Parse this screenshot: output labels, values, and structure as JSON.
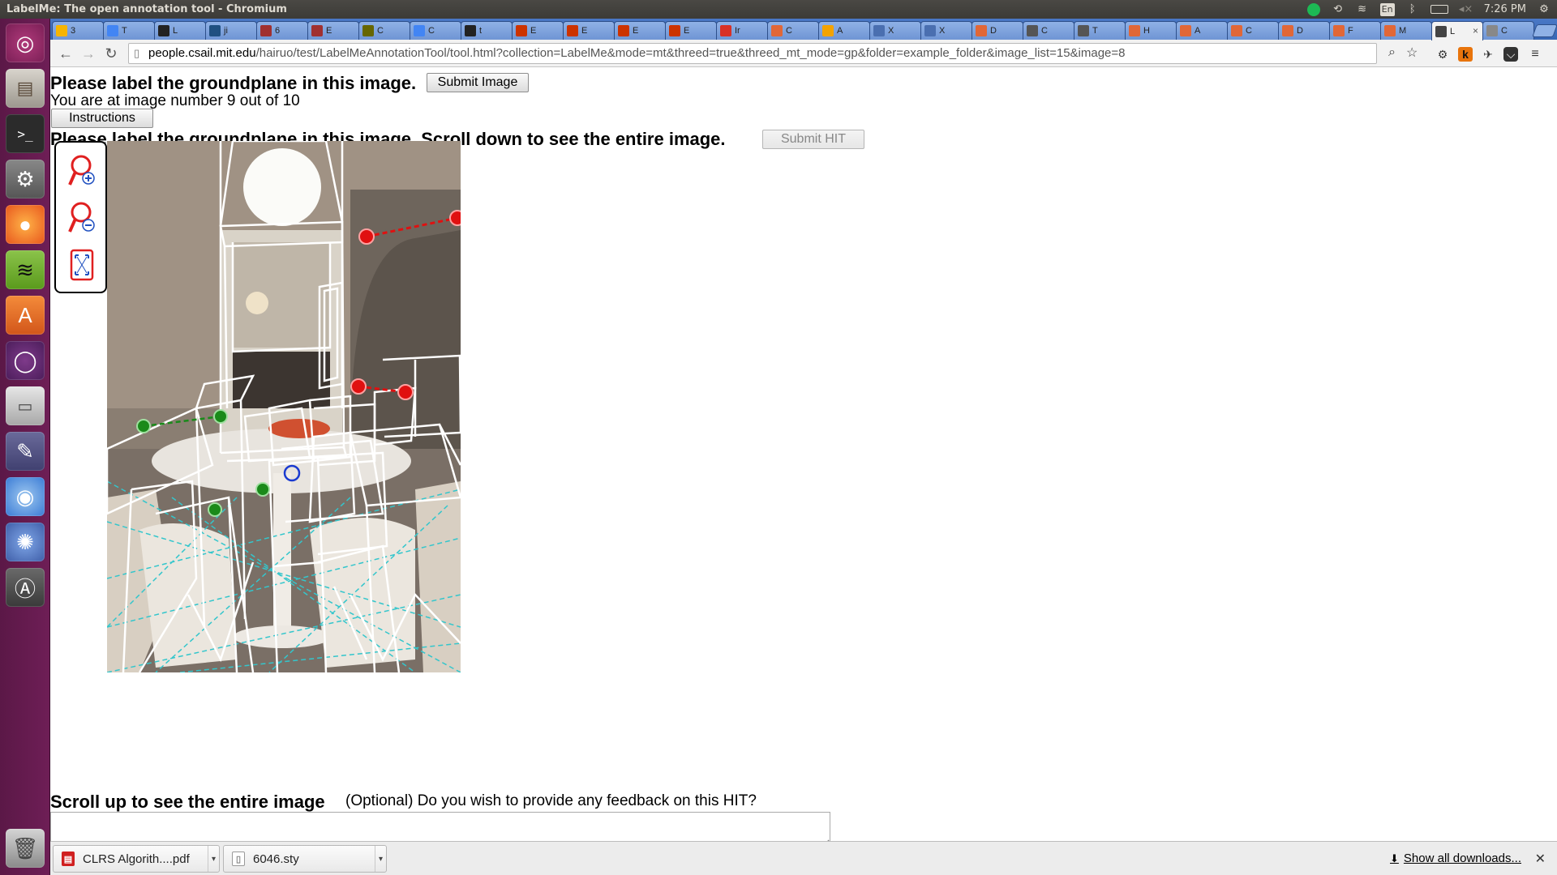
{
  "window": {
    "title": "LabelMe: The open annotation tool - Chromium"
  },
  "tray": {
    "clock": "7:26 PM",
    "keyboard": "En"
  },
  "launcher": {
    "items": [
      "ubuntu-home",
      "files",
      "terminal",
      "system-settings",
      "firefox",
      "spotify",
      "software-center",
      "ubuntu-one",
      "disk",
      "text-editor",
      "chromium",
      "shotwell",
      "software-updater",
      "trash"
    ]
  },
  "tabs": [
    {
      "icon": "drive-icon",
      "label": "3",
      "color": "#f6b400"
    },
    {
      "icon": "docs-icon",
      "label": "T",
      "color": "#4285f4"
    },
    {
      "icon": "github-icon",
      "label": "L",
      "color": "#222222"
    },
    {
      "icon": "jira-icon",
      "label": "ji",
      "color": "#205081"
    },
    {
      "icon": "bookmark-icon",
      "label": "6",
      "color": "#a03030"
    },
    {
      "icon": "bookmark-icon",
      "label": "E",
      "color": "#a03030"
    },
    {
      "icon": "misc-icon",
      "label": "C",
      "color": "#666600"
    },
    {
      "icon": "docs-icon",
      "label": "C",
      "color": "#4285f4"
    },
    {
      "icon": "github-icon",
      "label": "t",
      "color": "#222222"
    },
    {
      "icon": "wolfram-icon",
      "label": "E",
      "color": "#cc3300"
    },
    {
      "icon": "wolfram-icon",
      "label": "E",
      "color": "#cc3300"
    },
    {
      "icon": "wolfram-icon",
      "label": "E",
      "color": "#cc3300"
    },
    {
      "icon": "wolfram-icon",
      "label": "E",
      "color": "#cc3300"
    },
    {
      "icon": "gmail-icon",
      "label": "Ir",
      "color": "#d93025"
    },
    {
      "icon": "matlab-icon",
      "label": "C",
      "color": "#e16737"
    },
    {
      "icon": "circle-icon",
      "label": "A",
      "color": "#f4a300"
    },
    {
      "icon": "w3-icon",
      "label": "X",
      "color": "#4a6fb0"
    },
    {
      "icon": "w3-icon",
      "label": "X",
      "color": "#4a6fb0"
    },
    {
      "icon": "matlab-icon",
      "label": "D",
      "color": "#e16737"
    },
    {
      "icon": "wiki-icon",
      "label": "C",
      "color": "#555555"
    },
    {
      "icon": "wiki-icon",
      "label": "T",
      "color": "#555555"
    },
    {
      "icon": "matlab-icon",
      "label": "H",
      "color": "#e16737"
    },
    {
      "icon": "matlab-icon",
      "label": "A",
      "color": "#e16737"
    },
    {
      "icon": "matlab-icon",
      "label": "C",
      "color": "#e16737"
    },
    {
      "icon": "matlab-icon",
      "label": "D",
      "color": "#e16737"
    },
    {
      "icon": "matlab-icon",
      "label": "F",
      "color": "#e16737"
    },
    {
      "icon": "matlab-icon",
      "label": "M",
      "color": "#e16737"
    },
    {
      "icon": "labelme-icon",
      "label": "L",
      "color": "#444444",
      "active": true
    },
    {
      "icon": "misc-icon",
      "label": "C",
      "color": "#888888"
    }
  ],
  "toolbar": {
    "url_host": "people.csail.mit.edu",
    "url_path": "/hairuo/test/LabelMeAnnotationTool/tool.html?collection=LabelMe&mode=mt&threed=true&threed_mt_mode=gp&folder=example_folder&image_list=15&image=8"
  },
  "page": {
    "heading": "Please label the groundplane in this image.",
    "submit_image": "Submit Image",
    "progress_text": "You are at image number 9 out of 10",
    "instructions": "Instructions",
    "heading2": "Please label the groundplane in this image. Scroll down to see the entire image.",
    "submit_hit": "Submit HIT",
    "scroll_up": "Scroll up to see the entire image",
    "feedback_prompt": "(Optional) Do you wish to provide any feedback on this HIT?",
    "feedback_value": ""
  },
  "tools": [
    "zoom-in-icon",
    "zoom-out-icon",
    "fit-image-icon"
  ],
  "downloads": {
    "items": [
      {
        "name": "CLRS Algorith....pdf",
        "type": "pdf"
      },
      {
        "name": "6046.sty",
        "type": "file"
      }
    ],
    "show_all": "Show all downloads..."
  }
}
